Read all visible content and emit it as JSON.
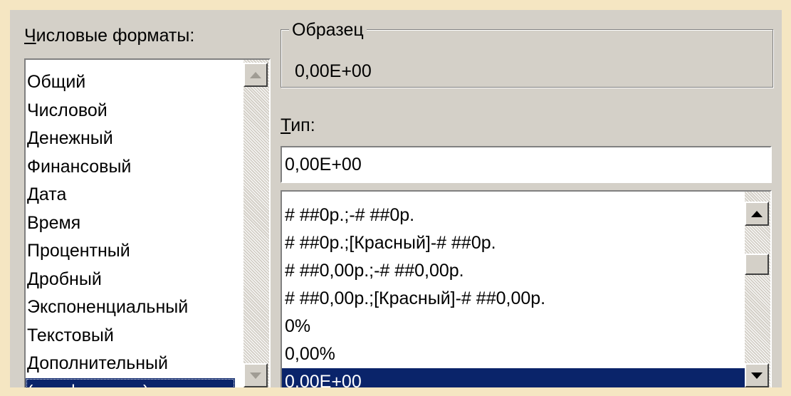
{
  "dialog": {
    "categories_label": "Числовые форматы:",
    "categories": [
      "Общий",
      "Числовой",
      "Денежный",
      "Финансовый",
      "Дата",
      "Время",
      "Процентный",
      "Дробный",
      "Экспоненциальный",
      "Текстовый",
      "Дополнительный",
      "(все форматы)"
    ],
    "selected_category": "(все форматы)",
    "sample": {
      "label": "Образец",
      "value": "0,00E+00"
    },
    "type": {
      "label": "Тип:",
      "value": "0,00E+00"
    },
    "formats": [
      "# ##0р.;-# ##0р.",
      "# ##0р.;[Красный]-# ##0р.",
      "# ##0,00р.;-# ##0,00р.",
      "# ##0,00р.;[Красный]-# ##0,00р.",
      "0%",
      "0,00%",
      "0,00E+00"
    ],
    "selected_format": "0,00E+00"
  },
  "colors": {
    "background": "#f5e6c2",
    "face": "#d4d0c8",
    "selection": "#0a246a"
  },
  "icons": [
    "scroll-up-arrow-icon",
    "scroll-down-arrow-icon"
  ]
}
